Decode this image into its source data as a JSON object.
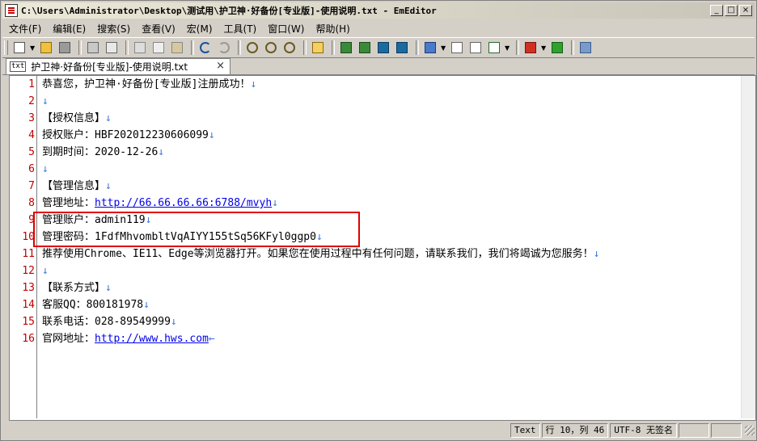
{
  "window": {
    "title": "C:\\Users\\Administrator\\Desktop\\测试用\\护卫神·好备份[专业版]-使用说明.txt - EmEditor",
    "minimize_label": "_",
    "maximize_label": "□",
    "close_label": "×"
  },
  "menu": {
    "items": [
      {
        "label": "文件(F)"
      },
      {
        "label": "编辑(E)"
      },
      {
        "label": "搜索(S)"
      },
      {
        "label": "查看(V)"
      },
      {
        "label": "宏(M)"
      },
      {
        "label": "工具(T)"
      },
      {
        "label": "窗口(W)"
      },
      {
        "label": "帮助(H)"
      }
    ]
  },
  "toolbar": {
    "icons": [
      "new-file-icon",
      "open-file-icon",
      "save-icon",
      "print-icon",
      "print-preview-icon",
      "cut-icon",
      "copy-icon",
      "paste-icon",
      "undo-icon",
      "redo-icon",
      "find-icon",
      "find-next-icon",
      "find-prev-icon",
      "highlight-icon",
      "view1-icon",
      "view2-icon",
      "view3-icon",
      "view4-icon",
      "config-icon",
      "marker-icon",
      "edit-icon",
      "checkbox-icon",
      "stop-icon",
      "play-icon",
      "tools-icon"
    ]
  },
  "tab": {
    "icon_text": "txt",
    "label": "护卫神·好备份[专业版]-使用说明.txt",
    "close": "×"
  },
  "editor": {
    "eol_mark": "↓",
    "eof_mark": "←",
    "lines": [
      {
        "num": "1",
        "text": "恭喜您，护卫神·好备份[专业版]注册成功！"
      },
      {
        "num": "2",
        "text": ""
      },
      {
        "num": "3",
        "text": "【授权信息】"
      },
      {
        "num": "4",
        "text": "授权账户：HBF202012230606099"
      },
      {
        "num": "5",
        "text": "到期时间：2020-12-26"
      },
      {
        "num": "6",
        "text": ""
      },
      {
        "num": "7",
        "text": "【管理信息】"
      },
      {
        "num": "8",
        "text": "管理地址：",
        "url": "http://66.66.66.66:6788/mvyh"
      },
      {
        "num": "9",
        "text": "管理账户：admin119"
      },
      {
        "num": "10",
        "text": "管理密码：1FdfMhvombltVqAIYY155tSq56KFyl0ggp0"
      },
      {
        "num": "11",
        "text": "推荐使用Chrome、IE11、Edge等浏览器打开。如果您在使用过程中有任何问题，请联系我们，我们将竭诚为您服务！"
      },
      {
        "num": "12",
        "text": ""
      },
      {
        "num": "13",
        "text": "【联系方式】"
      },
      {
        "num": "14",
        "text": "客服QQ：800181978"
      },
      {
        "num": "15",
        "text": "联系电话：028-89549999"
      },
      {
        "num": "16",
        "text": "官网地址：",
        "url": "http://www.hws.com"
      }
    ]
  },
  "status": {
    "mode": "Text",
    "position": "行 10，列 46",
    "encoding": "UTF-8 无签名"
  },
  "colors": {
    "line_number": "#c00000",
    "eol_mark": "#3c78d8",
    "url": "#0000ee",
    "highlight_box": "#e00000"
  }
}
